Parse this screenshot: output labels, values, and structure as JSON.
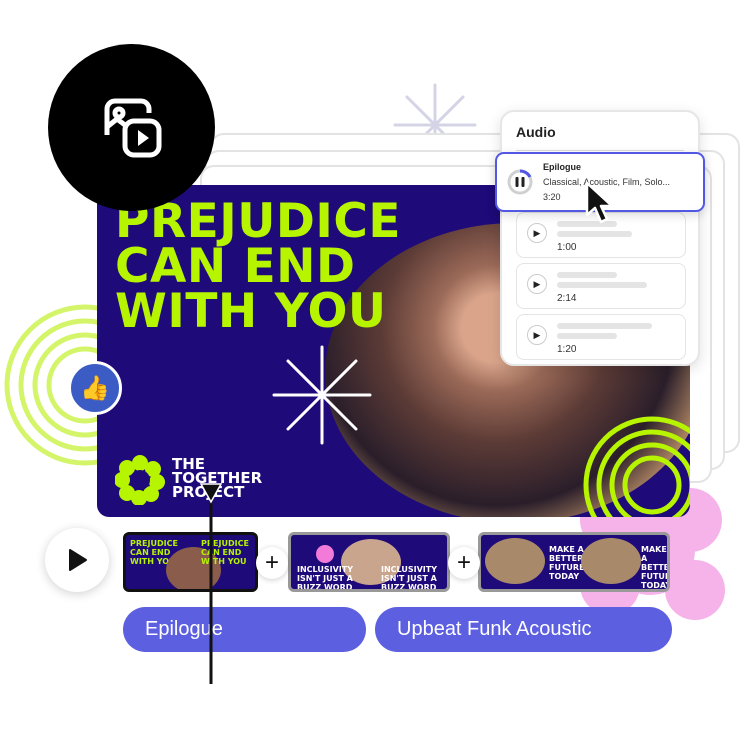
{
  "colors": {
    "card": "#1f0a7a",
    "accent_lime": "#b6f400",
    "selection": "#5258e4",
    "pill": "#5b5fe0",
    "flower": "#f4a6e6"
  },
  "feature_icon": "photo-video-icon",
  "card": {
    "headline": [
      "PREJUDICE",
      "CAN END",
      "WITH YOU"
    ],
    "logo_text": [
      "THE",
      "TOGETHER",
      "PROJECT"
    ]
  },
  "audio": {
    "title": "Audio",
    "selected": {
      "name": "Epilogue",
      "tags": "Classical, Acoustic, Film, Solo...",
      "duration": "3:20",
      "state": "playing"
    },
    "tracks": [
      {
        "duration": "1:00"
      },
      {
        "duration": "2:14"
      },
      {
        "duration": "1:20"
      }
    ]
  },
  "timeline": {
    "clips": [
      {
        "text": "PREJUDICE CAN END WITH YOU"
      },
      {
        "text": "INCLUSIVITY ISN'T JUST A BUZZ WORD"
      },
      {
        "text": "MAKE A BETTER FUTURE TODAY"
      }
    ],
    "tracks": [
      "Epilogue",
      "Upbeat Funk Acoustic"
    ]
  }
}
